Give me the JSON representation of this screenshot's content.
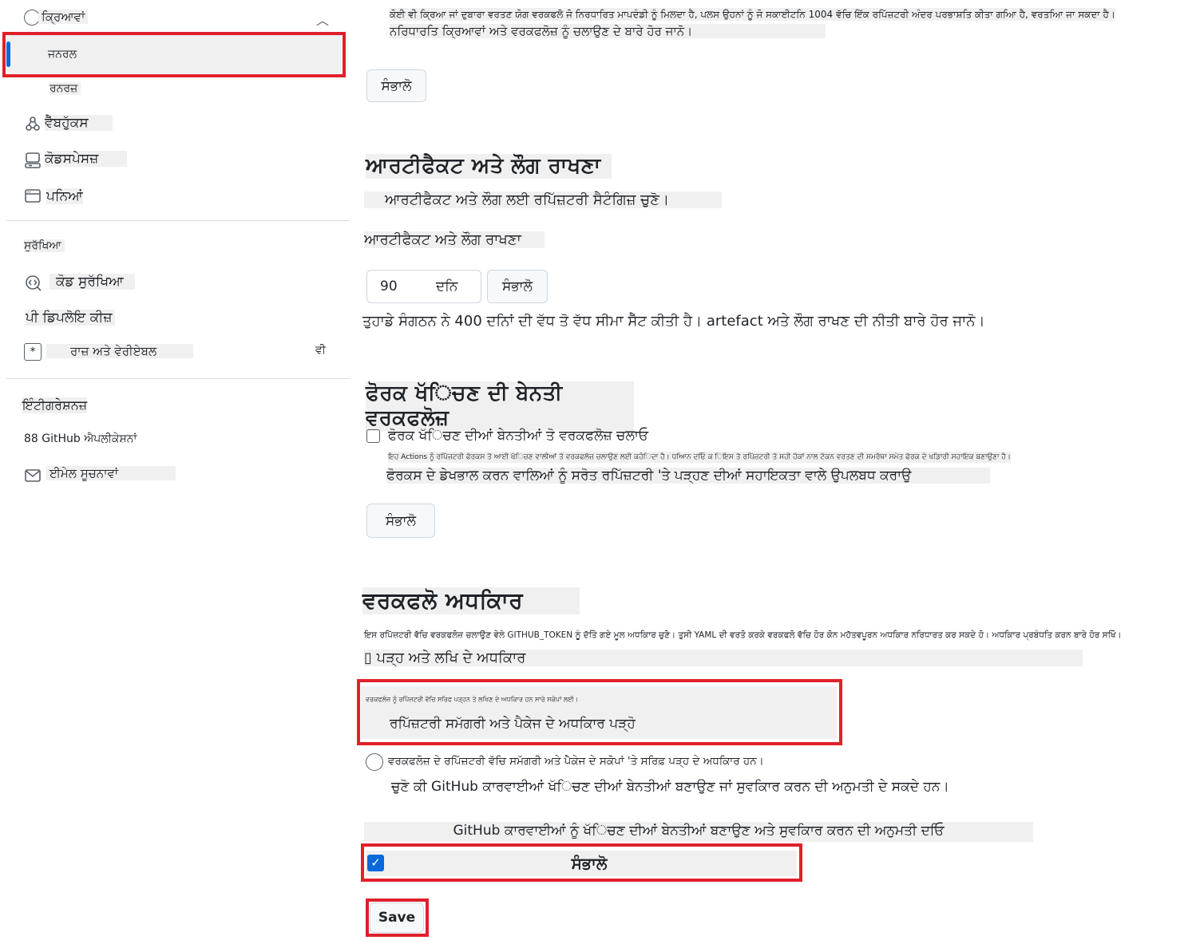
{
  "sidebar": {
    "actions_header": "ਕ੍ਰਿਆਵਾਂ",
    "items": [
      {
        "label": "ਜਨਰਲ"
      },
      {
        "label": "ਰਨਰਜ਼"
      },
      {
        "label": "ਵੈੱਬਹੁੱਕਸ"
      },
      {
        "label": "ਕੋਡਸਪੇਸਜ਼"
      },
      {
        "label": "ਪਨਿਆਂ"
      }
    ],
    "security_header": "ਸੁਰੱਖਿਆ",
    "security_items": [
      {
        "label": "ਕੋਡ ਸੁਰੱਖਿਆ"
      },
      {
        "label": "ਪੀ ਡਿਪਲੋਇ ਕੀਜ਼"
      },
      {
        "label": "ਰਾਜ਼ ਅਤੇ ਵੇਰੀਏਬਲ",
        "suffix": "ਵੀ"
      }
    ],
    "integrations_header": "ਇੰਟੀਗਰੇਸ਼ਨਜ਼",
    "integration_items": [
      {
        "label": "88 GitHub ਐਪਲੀਕੇਸ਼ਨਾਂ"
      },
      {
        "label": "ਈਮੇਲ ਸੂਚਨਾਵਾਂ"
      }
    ]
  },
  "main": {
    "intro_line1": "ਕੋਈ ਵੀ ਕ੍ਰਿਆ ਜਾਂ ਦੁਬਾਰਾ ਵਰਤਣ ਯੋਗ ਵਰਕਫਲੋ ਜੋ ਨਿਰਧਾਰਿਤ ਮਾਪਦੰਡੀ ਨੂੰ ਮਿਲਦਾ ਹੈ, ਪਲਸ ਉਹਨਾਂ ਨੂੰ ਜੋ ਸਕਾਈਟਨਿ 1004 ਵੱਚਿ ਇੱਕ ਰਪਿੱਜ਼ਟਰੀ ਅੰਦਰ ਪਰਭਾਸ਼ਤਿ ਕੀਤਾ ਗਆਿ ਹੈ, ਵਰਤਆਿ ਜਾ ਸਕਦਾ ਹੈ।",
    "intro_line2": "ਨਰਿਧਾਰਤਿ ਕ੍ਰਿਆਵਾਂ ਅਤੇ ਵਰਕਫਲੋਜ਼ ਨੂੰ ਚਲਾਉਣ ਦੇ ਬਾਰੇ ਹੋਰ ਜਾਨੋ।",
    "save_btn_1": "ਸੰਭਾਲੋ",
    "artifact_title": "ਆਰਟੀਫੈਕਟ ਅਤੇ ਲੌਗ ਰਾਖਣਾ",
    "artifact_subtitle": "ਆਰਟੀਫੈਕਟ ਅਤੇ ਲੌਗ ਲਈ ਰਪਿੱਜ਼ਟਰੀ ਸੈਟੰਗਿਜ਼ ਚੁਣੋ।",
    "artifact_label": "ਆਰਟੀਫੈਕਟ ਅਤੇ ਲੌਗ ਰਾਖਣਾ",
    "retention_value": "90",
    "retention_unit": "ਦਨਿ",
    "save_btn_2": "ਸੰਭਾਲੋ",
    "retention_note": "ਤੁਹਾਡੇ ਸੰਗਠਨ ਨੇ 400 ਦਨਿਾਂ ਦੀ ਵੱਧ ਤੋ ਵੱਧ ਸੀਮਾ ਸੈੱਟ ਕੀਤੀ ਹੈ। artefact ਅਤੇ ਲੌਗ ਰਾਖਣ ਦੀ ਨੀਤੀ ਬਾਰੇ ਹੋਰ ਜਾਨੋ।",
    "fork_title": "ਫੋਰਕ ਖੱਿਚਣ ਦੀ ਬੇਨਤੀ ਵਰਕਫਲੋਜ਼",
    "fork_checkbox_label": "ਫੋਰਕ ਖੱਿਚਣ ਦੀਆਂ ਬੇਨਤੀਆਂ ਤੋ ਵਰਕਫਲੋਜ਼ ਚਲਾਓ",
    "fork_small_note": "ਇਹ Actions ਨੂੰ ਰਪਿੱਜ਼ਟਰੀ ਫੋਰਕਸ ਤੋ ਆਈ ਖੱਿਚਣ ਵਾਲੀਆਂ ਤੋ ਵਰਕਫਲੋਜ਼ ਚਲਾਉਣ ਲਈ ਕਹੰਿਦਾ ਹੈ। ਧਆਿਨ ਦਓਿ ਕ ਿਇਸ ਤੋ ਰਪਿੱਜ਼ਟਰੀ ਤੋ ਸਹੀ ਹੱਕਾਂ ਨਾਲ ਟੋਕਨ ਵਰਤਣ ਦੀ ਸਮਰੱਥਾ ਸਮੇਤ ਫੋਰਕ ਦੇ ਖਡਿਾਰੀ ਸਹਾਇਕ ਬਣਾਉਣਾ ਹੈ।",
    "fork_option": "ਫੋਰਕਸ ਦੇ ਡੇਖਭਾਲ ਕਰਨ ਵਾਲਿਆਂ ਨੂੰ ਸਰੋਤ ਰਪਿੱਜ਼ਟਰੀ 'ਤੇ ਪੜ੍ਹਣ ਦੀਆਂ ਸਹਾਇਕਤਾ ਵਾਲੇ ਉਪਲਬਧ ਕਰਾਉ",
    "save_btn_3": "ਸੰਭਾਲੋ",
    "perm_title": "ਵਰਕਫਲੋ ਅਧਕਿਾਰ",
    "perm_desc": "ਇਸ ਰਪਿੱਜ਼ਟਰੀ ਵੱਚਿ ਵਰਕਫਲੋਜ਼ ਚਲਾਉਣ ਵੇਲੇ GITHUB_TOKEN ਨੂੰ ਦੱਤਿੇ ਗਏ ਮੂਲ ਅਧਕਿਾਰ ਚੁਣੋ। ਤੁਸੀ YAML ਦੀ ਵਰਤੋ ਕਰਕੇ ਵਰਕਫਲੋ ਵੱਚਿ ਹੋਰ ਕੋਨ ਮਹੱਤਵਪੂਰਨ ਅਧਕਿਾਰ ਨਰਿਧਾਰਤ ਕਰ ਸਕਦੇ ਹੋ। ਅਧਕਿਾਰ ਪ੍ਰਬੰਧਤਿ ਕਰਨ ਬਾਰੇ ਹੋਰ ਸਖਿੋ।",
    "rw_label": "▯ ਪੜ੍ਹ ਅਤੇ ਲਖਿ ਦੇ ਅਧਕਿਾਰ",
    "read_small": "ਵਰਕਫਲੋਜ਼ ਨੂੰ ਰਪਿੱਜ਼ਟਰੀ ਵੱਚਿ ਸਰਿਫ ਪੜ੍ਹਨ ਤੇ ਲਖਿਣ ਦੇ ਅਧਕਿਾਰ ਹਨ ਸਾਰੇ ਸਕੋਪਾਂ ਲਈ।",
    "read_option": "ਰਪਿੱਜ਼ਟਰੀ ਸਮੱਗਰੀ ਅਤੇ ਪੈਕੇਜ ਦੇ ਅਧਕਿਾਰ ਪੜ੍ਹੋ",
    "read_desc": "ਵਰਕਫਲੋਜ਼ ਦੇ ਰਪਿੱਜ਼ਟਰੀ ਵੱਚਿ ਸਮੱਗਰੀ ਅਤੇ ਪੈਕੇਜ ਦੇ ਸਕੋਪਾਂ 'ਤੇ ਸਰਿਫ਼ ਪੜ੍ਹ ਦੇ ਅਧਕਿਾਰ ਹਨ।",
    "choose_text": "ਚੁਣੋ ਕੀ GitHub ਕਾਰਵਾਈਆਂ ਖੱਿਚਣ ਦੀਆਂ ਬੇਨਤੀਆਂ ਬਣਾਉਣ ਜਾਂ ਸੁਵਕਿਾਰ ਕਰਨ ਦੀ ਅਨੁਮਤੀ ਦੇ ਸਕਦੇ ਹਨ।",
    "allow_label": "GitHub ਕਾਰਵਾਈਆਂ ਨੂੰ ਖੱਿਚਣ ਦੀਆਂ ਬੇਨਤੀਆਂ ਬਣਾਉਣ ਅਤੇ ਸੁਵਕਿਾਰ ਕਰਨ ਦੀ ਅਨੁਮਤੀ ਦਓਿ",
    "allow_checkbox_text": "ਸੰਭਾਲੋ",
    "save_label": "Save"
  },
  "colors": {
    "highlight": "#e0202a",
    "accent_blue": "#0969da"
  }
}
